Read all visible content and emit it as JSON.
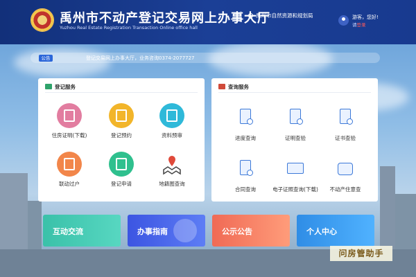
{
  "header": {
    "title_cn": "禹州市不动产登记交易网上办事大厅",
    "title_en": "Yuzhou Real Estate Registration Transaction Online office hall",
    "location": "禹州市自然资源和规划局",
    "greeting": "游客，您好!",
    "login_prefix": "请",
    "login_link": "登录"
  },
  "notice": {
    "badge": "公告",
    "text": "登记交易网上办事大厅，业务咨询0374-2077727"
  },
  "registration": {
    "title": "登记服务",
    "items": [
      {
        "label": "住房证明(下载)",
        "icon": "house-certificate-icon",
        "color": "#e27da0"
      },
      {
        "label": "登记预约",
        "icon": "calendar-icon",
        "color": "#f2b52a"
      },
      {
        "label": "资料预审",
        "icon": "document-review-icon",
        "color": "#2fb9d9"
      },
      {
        "label": "联动过户",
        "icon": "transfer-icon",
        "color": "#f2864a"
      },
      {
        "label": "登记申请",
        "icon": "application-icon",
        "color": "#2fc08e"
      },
      {
        "label": "地籍图查询",
        "icon": "map-pin-icon",
        "color": "#555555"
      }
    ]
  },
  "query": {
    "title": "查询服务",
    "items": [
      {
        "label": "进度查询",
        "icon": "progress-icon"
      },
      {
        "label": "证明查验",
        "icon": "proof-check-icon"
      },
      {
        "label": "证书查验",
        "icon": "certificate-check-icon"
      },
      {
        "label": "合同查询",
        "icon": "contract-icon"
      },
      {
        "label": "电子证照查询(下载)",
        "icon": "e-license-icon"
      },
      {
        "label": "不动产住意查",
        "icon": "property-icon"
      }
    ]
  },
  "cards": [
    {
      "label": "互动交流"
    },
    {
      "label": "办事指南"
    },
    {
      "label": "公示公告"
    },
    {
      "label": "个人中心"
    }
  ],
  "watermark": "问房管助手"
}
